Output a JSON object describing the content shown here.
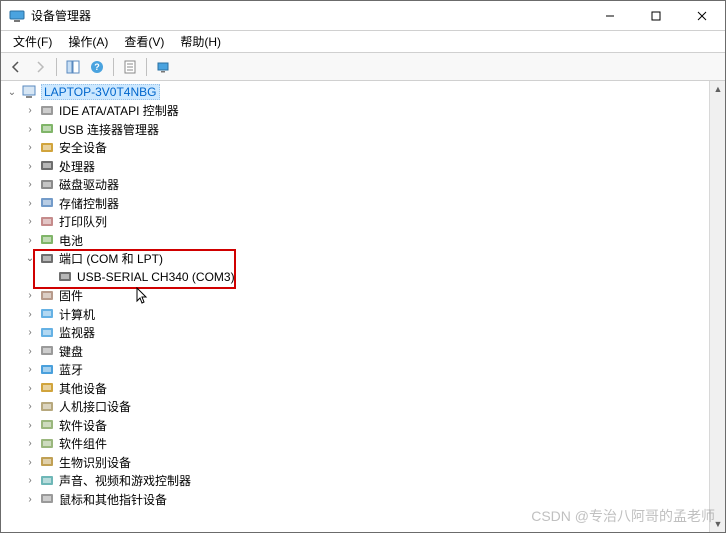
{
  "window": {
    "title": "设备管理器"
  },
  "menu": {
    "file": "文件(F)",
    "action": "操作(A)",
    "view": "查看(V)",
    "help": "帮助(H)"
  },
  "root": {
    "label": "LAPTOP-3V0T4NBG"
  },
  "nodes": [
    {
      "label": "IDE ATA/ATAPI 控制器",
      "expanded": false
    },
    {
      "label": "USB 连接器管理器",
      "expanded": false
    },
    {
      "label": "安全设备",
      "expanded": false
    },
    {
      "label": "处理器",
      "expanded": false
    },
    {
      "label": "磁盘驱动器",
      "expanded": false
    },
    {
      "label": "存储控制器",
      "expanded": false
    },
    {
      "label": "打印队列",
      "expanded": false
    },
    {
      "label": "电池",
      "expanded": false
    },
    {
      "label": "端口 (COM 和 LPT)",
      "expanded": true,
      "children": [
        {
          "label": "USB-SERIAL CH340 (COM3)"
        }
      ]
    },
    {
      "label": "固件",
      "expanded": false
    },
    {
      "label": "计算机",
      "expanded": false
    },
    {
      "label": "监视器",
      "expanded": false
    },
    {
      "label": "键盘",
      "expanded": false
    },
    {
      "label": "蓝牙",
      "expanded": false
    },
    {
      "label": "其他设备",
      "expanded": false
    },
    {
      "label": "人机接口设备",
      "expanded": false
    },
    {
      "label": "软件设备",
      "expanded": false
    },
    {
      "label": "软件组件",
      "expanded": false
    },
    {
      "label": "生物识别设备",
      "expanded": false
    },
    {
      "label": "声音、视频和游戏控制器",
      "expanded": false
    },
    {
      "label": "鼠标和其他指针设备",
      "expanded": false
    }
  ],
  "watermark": "CSDN @专治八阿哥的孟老师"
}
